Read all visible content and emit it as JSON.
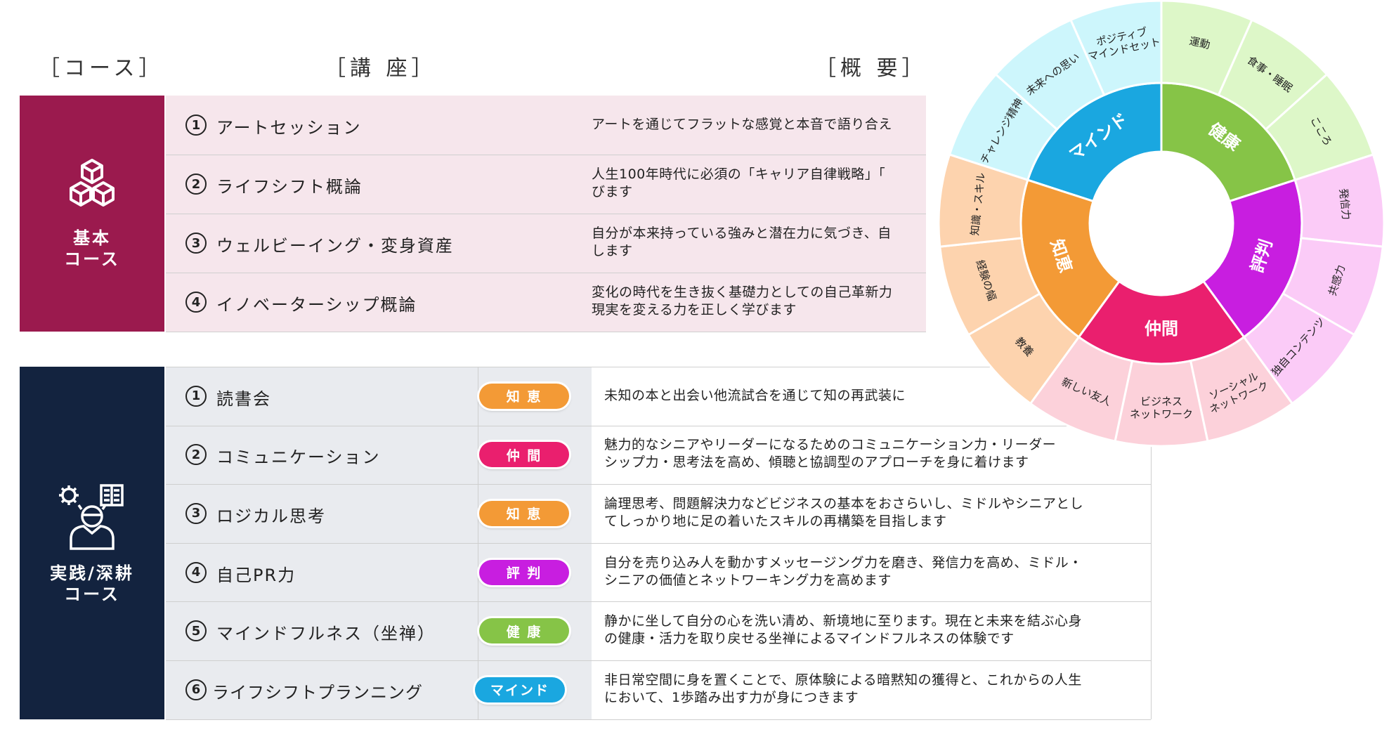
{
  "headers": {
    "course": "［コース］",
    "lecture": "［講 座］",
    "summary": "［概 要］"
  },
  "basic": {
    "label": "基本\nコース",
    "color": "#9b1a4e",
    "rows": [
      {
        "num": "1",
        "title": "アートセッション",
        "summary": "アートを通じてフラットな感覚と本音で語り合え"
      },
      {
        "num": "2",
        "title": "ライフシフト概論",
        "summary": "人生100年時代に必須の「キャリア自律戦略」「\nびます"
      },
      {
        "num": "3",
        "title": "ウェルビーイング・変身資産",
        "summary": "自分が本来持っている強みと潜在力に気づき、自\nします"
      },
      {
        "num": "4",
        "title": "イノベーターシップ概論",
        "summary": "変化の時代を生き抜く基礎力としての自己革新力\n現実を変える力を正しく学びます"
      }
    ]
  },
  "practice": {
    "label": "実践/深耕\nコース",
    "color": "#13233f",
    "rows": [
      {
        "num": "1",
        "title": "読書会",
        "tag": "知 恵",
        "tag_color": "#f39a36",
        "summary": "未知の本と出会い他流試合を通じて知の再武装に"
      },
      {
        "num": "2",
        "title": "コミュニケーション",
        "tag": "仲 間",
        "tag_color": "#ea1f6e",
        "summary": "魅力的なシニアやリーダーになるためのコミュニケーション力・リーダー\nシップ力・思考法を高め、傾聴と協調型のアプローチを身に着けます"
      },
      {
        "num": "3",
        "title": "ロジカル思考",
        "tag": "知 恵",
        "tag_color": "#f39a36",
        "summary": "論理思考、問題解決力などビジネスの基本をおさらいし、ミドルやシニアとし\nてしっかり地に足の着いたスキルの再構築を目指します"
      },
      {
        "num": "4",
        "title": "自己PR力",
        "tag": "評 判",
        "tag_color": "#c81ee0",
        "summary": "自分を売り込み人を動かすメッセージング力を磨き、発信力を高め、ミドル・\nシニアの価値とネットワーキング力を高めます"
      },
      {
        "num": "5",
        "title": "マインドフルネス（坐禅）",
        "tag": "健 康",
        "tag_color": "#86c447",
        "summary": "静かに坐して自分の心を洗い清め、新境地に至ります。現在と未来を結ぶ心身\nの健康・活力を取り戻せる坐禅によるマインドフルネスの体験です"
      },
      {
        "num": "6",
        "title": "ライフシフトプランニング",
        "tag": "マインド",
        "tag_color": "#1aa7e0",
        "summary": "非日常空間に身を置くことで、原体験による暗黙知の獲得と、これからの人生\nにおいて、1歩踏み出す力が身につきます"
      }
    ]
  },
  "wheel": {
    "segments": [
      {
        "label": "マインド",
        "color": "#1aa7e0",
        "outer_color": "#cdf6fc",
        "children": [
          "チャレンジ精神",
          "未来への思い",
          "ポジティブ\nマインドセット"
        ]
      },
      {
        "label": "健康",
        "color": "#86c447",
        "outer_color": "#ddf7c8",
        "children": [
          "運動",
          "食事・睡眠",
          "こころ"
        ]
      },
      {
        "label": "評判",
        "color": "#c81ee0",
        "outer_color": "#fbcbf7",
        "children": [
          "発信力",
          "共感力",
          "独自コンテンツ"
        ]
      },
      {
        "label": "仲間",
        "color": "#ea1f6e",
        "outer_color": "#fcd1da",
        "children": [
          "ソーシャル\nネットワーク",
          "ビジネス\nネットワーク",
          "新しい友人"
        ]
      },
      {
        "label": "知恵",
        "color": "#f39a36",
        "outer_color": "#fdd3ae",
        "children": [
          "教養",
          "経験の幅",
          "知識・スキル"
        ]
      }
    ]
  }
}
